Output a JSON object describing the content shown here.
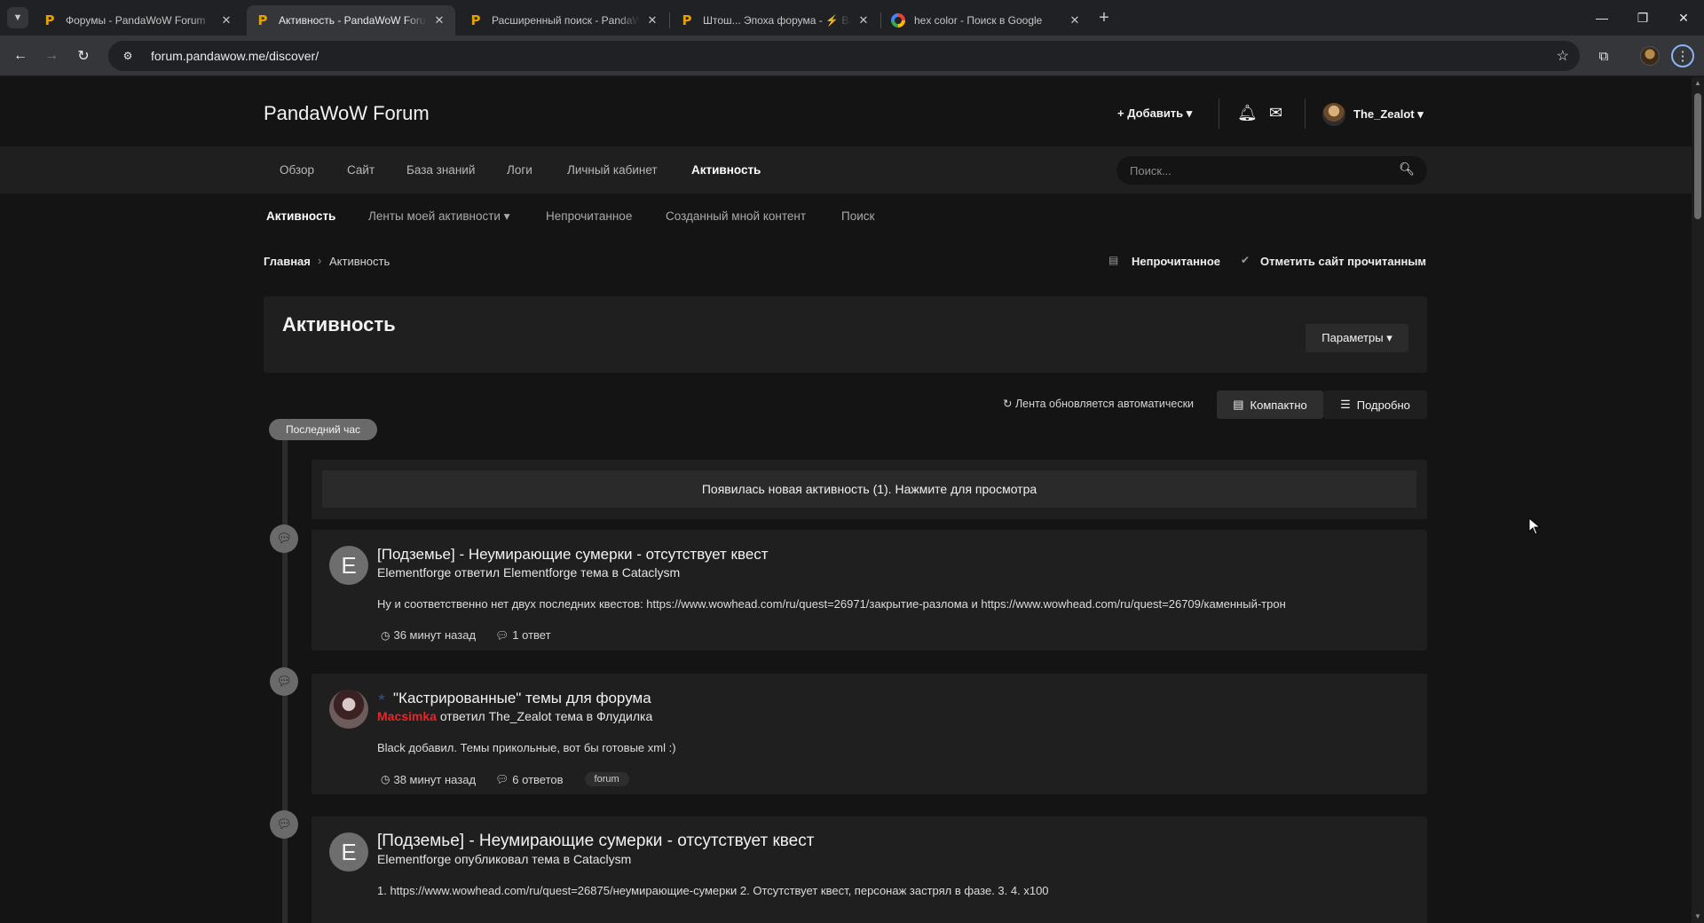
{
  "browser": {
    "tabs": [
      {
        "title": "Форумы - PandaWoW Forum",
        "favicon": "P",
        "active": false
      },
      {
        "title": "Активность - PandaWoW Forum",
        "favicon": "P",
        "active": true
      },
      {
        "title": "Расширенный поиск - PandaWoW Forum",
        "favicon": "P",
        "active": false
      },
      {
        "title": "Штош... Эпоха форума - ⚡ BC",
        "favicon": "P",
        "active": false
      },
      {
        "title": "hex color - Поиск в Google",
        "favicon": "G",
        "active": false
      }
    ],
    "url": "forum.pandawow.me/discover/"
  },
  "header": {
    "site_title": "PandaWoW Forum",
    "add_label": "+ Добавить ▾",
    "username": "The_Zealot ▾"
  },
  "mainnav": {
    "items": [
      "Обзор",
      "Сайт",
      "База знаний",
      "Логи",
      "Личный кабинет",
      "Активность"
    ],
    "search_placeholder": "Поиск..."
  },
  "subnav": {
    "items": [
      "Активность",
      "Ленты моей активности ▾",
      "Непрочитанное",
      "Созданный мной контент",
      "Поиск"
    ]
  },
  "breadcrumb": {
    "items": [
      "Главная",
      "Активность"
    ],
    "unread_link": "Непрочитанное",
    "mark_read_link": "Отметить сайт прочитанным"
  },
  "panel": {
    "title": "Активность",
    "params_label": "Параметры ▾"
  },
  "view": {
    "autoupdate": "Лента обновляется автоматически",
    "compact": "Компактно",
    "detailed": "Подробно"
  },
  "timeline": {
    "period": "Последний час",
    "new_activity": "Появилась новая активность (1). Нажмите для просмотра"
  },
  "feed": [
    {
      "avatar_letter": "E",
      "title": "[Подземье] - Неумирающие сумерки - отсутствует квест",
      "author": "Elementforge",
      "action": "ответил Elementforge тема в Cataclysm",
      "snippet": "Ну и соответственно нет двух последних квестов: https://www.wowhead.com/ru/quest=26971/закрытие-разлома и https://www.wowhead.com/ru/quest=26709/каменный-трон",
      "time": "36 минут назад",
      "replies": "1 ответ"
    },
    {
      "avatar_letter": "",
      "title": "\"Кастрированные\" темы для форума",
      "author": "Macsimka",
      "action": "ответил The_Zealot тема в Флудилка",
      "snippet": "Black добавил. Темы прикольные, вот бы готовые xml :)",
      "time": "38 минут назад",
      "replies": "6 ответов",
      "tag": "forum"
    },
    {
      "avatar_letter": "E",
      "title": "[Подземье] - Неумирающие сумерки - отсутствует квест",
      "author": "Elementforge",
      "action": "опубликовал тема в Cataclysm",
      "snippet": "1. https://www.wowhead.com/ru/quest=26875/неумирающие-сумерки 2. Отсутствует квест, персонаж застрял в фазе. 3. 4. x100"
    }
  ]
}
